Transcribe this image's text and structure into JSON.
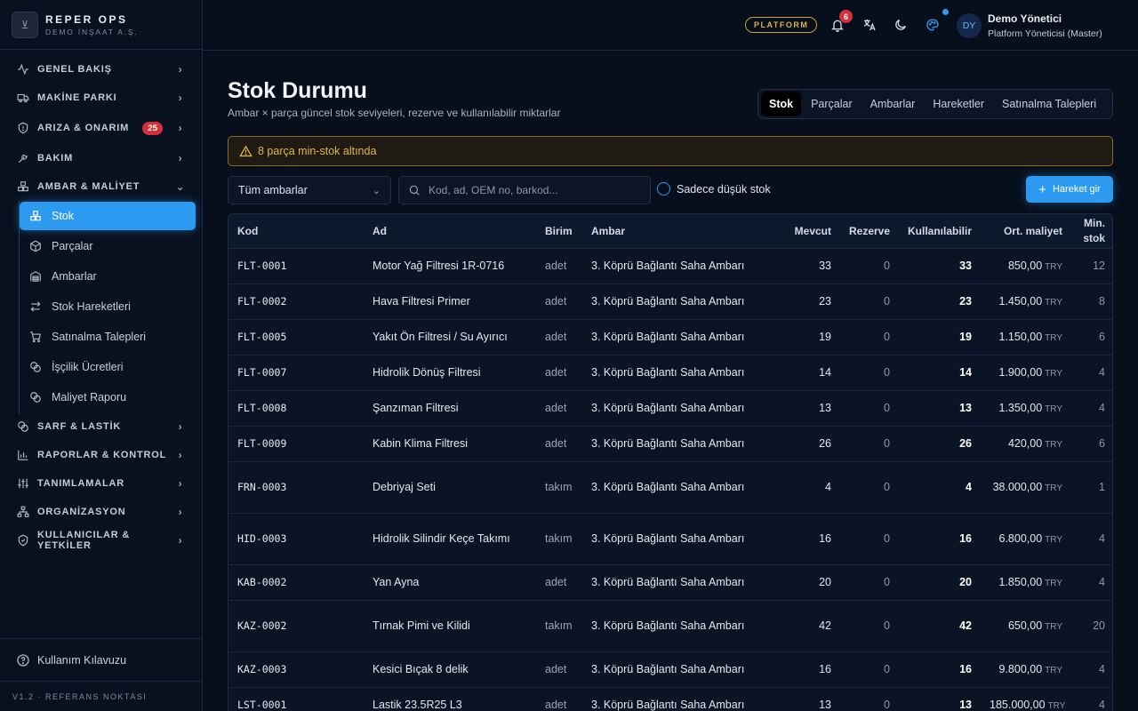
{
  "brand": {
    "logo_glyph": "⊻",
    "name": "REPER OPS",
    "subtitle": "DEMO İNŞAAT A.Ş."
  },
  "sidebar": {
    "sections": [
      {
        "label": "GENEL BAKIŞ",
        "icon": "activity-icon"
      },
      {
        "label": "MAKİNE PARKI",
        "icon": "truck-icon"
      },
      {
        "label": "ARIZA & ONARIM",
        "icon": "shield-alert-icon",
        "badge": "25"
      },
      {
        "label": "BAKIM",
        "icon": "wrench-icon"
      },
      {
        "label": "AMBAR & MALİYET",
        "icon": "boxes-icon",
        "expanded": true
      },
      {
        "label": "SARF & LASTİK",
        "icon": "coins-icon"
      },
      {
        "label": "RAPORLAR & KONTROL",
        "icon": "bar-chart-icon"
      },
      {
        "label": "TANIMLAMALAR",
        "icon": "sliders-icon"
      },
      {
        "label": "ORGANİZASYON",
        "icon": "network-icon"
      },
      {
        "label": "KULLANICILAR & YETKİLER",
        "icon": "shield-check-icon"
      }
    ],
    "sub_items": [
      {
        "label": "Stok",
        "icon": "boxes-icon",
        "active": true
      },
      {
        "label": "Parçalar",
        "icon": "package-icon"
      },
      {
        "label": "Ambarlar",
        "icon": "warehouse-icon"
      },
      {
        "label": "Stok Hareketleri",
        "icon": "arrows-icon"
      },
      {
        "label": "Satınalma Talepleri",
        "icon": "cart-icon"
      },
      {
        "label": "İşçilik Ücretleri",
        "icon": "coins-icon"
      },
      {
        "label": "Maliyet Raporu",
        "icon": "coins-icon"
      }
    ],
    "guide_label": "Kullanım Kılavuzu",
    "version": "V1.2 · REFERANS NOKTASI"
  },
  "topbar": {
    "platform_label": "PLATFORM",
    "notification_count": "6",
    "user_initials": "DY",
    "user_name": "Demo Yönetici",
    "user_role": "Platform Yöneticisi (Master)"
  },
  "page": {
    "title": "Stok Durumu",
    "subtitle": "Ambar × parça güncel stok seviyeleri, rezerve ve kullanılabilir miktarlar",
    "tabs": [
      "Stok",
      "Parçalar",
      "Ambarlar",
      "Hareketler",
      "Satınalma Talepleri"
    ],
    "active_tab": "Stok",
    "alert": "8 parça min-stok altında"
  },
  "filters": {
    "warehouse_select": "Tüm ambarlar",
    "search_placeholder": "Kod, ad, OEM no, barkod...",
    "search_value": "",
    "low_stock_label": "Sadece düşük stok",
    "low_stock_checked": false,
    "add_movement_label": "Hareket gir"
  },
  "table": {
    "columns": [
      "Kod",
      "Ad",
      "Birim",
      "Ambar",
      "Mevcut",
      "Rezerve",
      "Kullanılabilir",
      "Ort. maliyet",
      "Min. stok"
    ],
    "rows": [
      {
        "code": "FLT-0001",
        "name": "Motor Yağ Filtresi 1R-0716",
        "unit": "adet",
        "warehouse": "3. Köprü Bağlantı Saha Ambarı",
        "current": "33",
        "reserved": "0",
        "available": "33",
        "cost": "850,00",
        "currency": "TRY",
        "min": "12"
      },
      {
        "code": "FLT-0002",
        "name": "Hava Filtresi Primer",
        "unit": "adet",
        "warehouse": "3. Köprü Bağlantı Saha Ambarı",
        "current": "23",
        "reserved": "0",
        "available": "23",
        "cost": "1.450,00",
        "currency": "TRY",
        "min": "8"
      },
      {
        "code": "FLT-0005",
        "name": "Yakıt Ön Filtresi / Su Ayırıcı",
        "unit": "adet",
        "warehouse": "3. Köprü Bağlantı Saha Ambarı",
        "current": "19",
        "reserved": "0",
        "available": "19",
        "cost": "1.150,00",
        "currency": "TRY",
        "min": "6"
      },
      {
        "code": "FLT-0007",
        "name": "Hidrolik Dönüş Filtresi",
        "unit": "adet",
        "warehouse": "3. Köprü Bağlantı Saha Ambarı",
        "current": "14",
        "reserved": "0",
        "available": "14",
        "cost": "1.900,00",
        "currency": "TRY",
        "min": "4"
      },
      {
        "code": "FLT-0008",
        "name": "Şanzıman Filtresi",
        "unit": "adet",
        "warehouse": "3. Köprü Bağlantı Saha Ambarı",
        "current": "13",
        "reserved": "0",
        "available": "13",
        "cost": "1.350,00",
        "currency": "TRY",
        "min": "4"
      },
      {
        "code": "FLT-0009",
        "name": "Kabin Klima Filtresi",
        "unit": "adet",
        "warehouse": "3. Köprü Bağlantı Saha Ambarı",
        "current": "26",
        "reserved": "0",
        "available": "26",
        "cost": "420,00",
        "currency": "TRY",
        "min": "6"
      },
      {
        "code": "FRN-0003",
        "name": "Debriyaj Seti",
        "unit": "takım",
        "warehouse": "3. Köprü Bağlantı Saha Ambarı",
        "current": "4",
        "reserved": "0",
        "available": "4",
        "cost": "38.000,00",
        "currency": "TRY",
        "min": "1"
      },
      {
        "code": "HID-0003",
        "name": "Hidrolik Silindir Keçe Takımı",
        "unit": "takım",
        "warehouse": "3. Köprü Bağlantı Saha Ambarı",
        "current": "16",
        "reserved": "0",
        "available": "16",
        "cost": "6.800,00",
        "currency": "TRY",
        "min": "4"
      },
      {
        "code": "KAB-0002",
        "name": "Yan Ayna",
        "unit": "adet",
        "warehouse": "3. Köprü Bağlantı Saha Ambarı",
        "current": "20",
        "reserved": "0",
        "available": "20",
        "cost": "1.850,00",
        "currency": "TRY",
        "min": "4"
      },
      {
        "code": "KAZ-0002",
        "name": "Tırnak Pimi ve Kilidi",
        "unit": "takım",
        "warehouse": "3. Köprü Bağlantı Saha Ambarı",
        "current": "42",
        "reserved": "0",
        "available": "42",
        "cost": "650,00",
        "currency": "TRY",
        "min": "20"
      },
      {
        "code": "KAZ-0003",
        "name": "Kesici Bıçak 8 delik",
        "unit": "adet",
        "warehouse": "3. Köprü Bağlantı Saha Ambarı",
        "current": "16",
        "reserved": "0",
        "available": "16",
        "cost": "9.800,00",
        "currency": "TRY",
        "min": "4"
      },
      {
        "code": "LST-0001",
        "name": "Lastik 23.5R25 L3",
        "unit": "adet",
        "warehouse": "3. Köprü Bağlantı Saha Ambarı",
        "current": "13",
        "reserved": "0",
        "available": "13",
        "cost": "185.000,00",
        "currency": "TRY",
        "min": "4"
      }
    ]
  },
  "colors": {
    "accent": "#2b9af0",
    "badge": "#d5303a",
    "warning": "#e2b54b",
    "background": "#070f1c"
  }
}
